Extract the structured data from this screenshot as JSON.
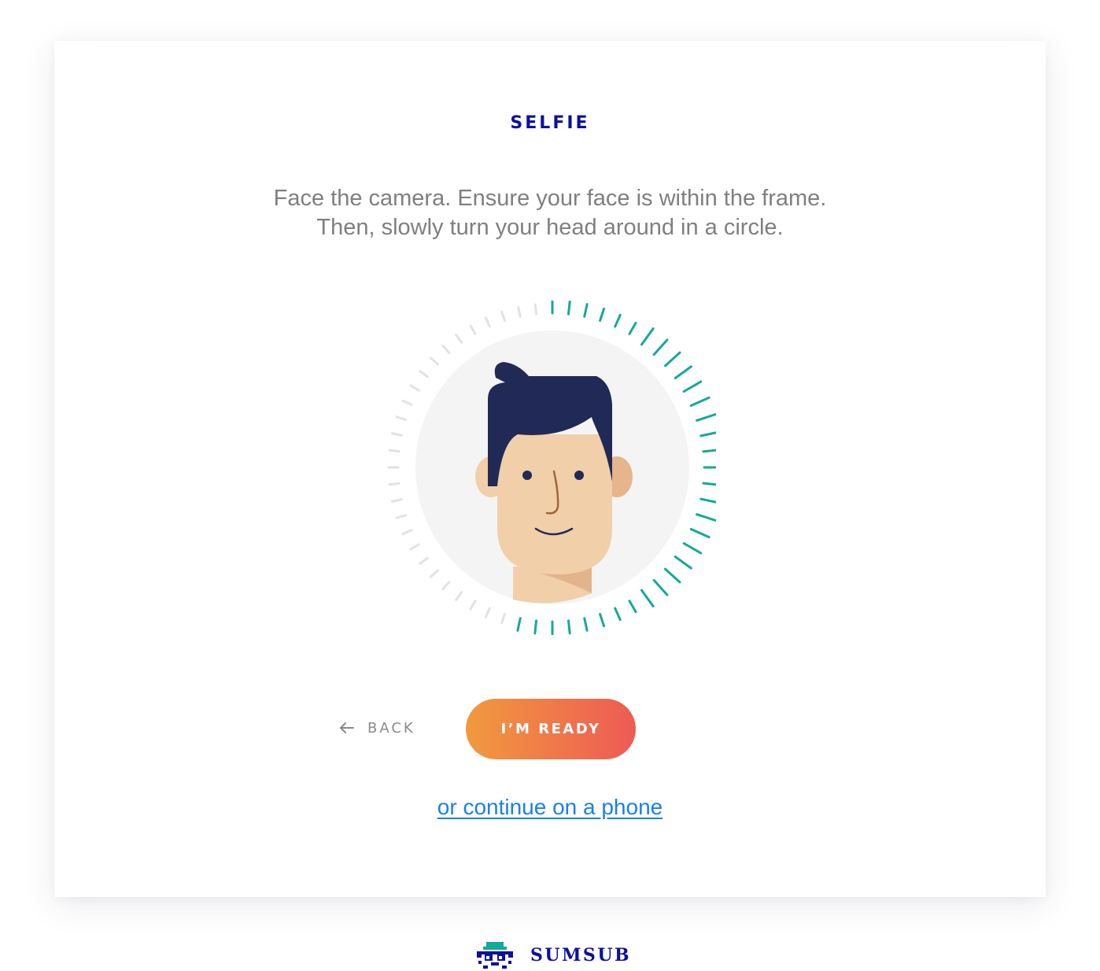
{
  "page": {
    "title": "SELFIE",
    "instructions": [
      "Face the camera. Ensure your face is within the frame.",
      "Then, slowly turn your head around in a circle."
    ]
  },
  "actions": {
    "back_label": "BACK",
    "ready_label": "I’M READY",
    "phone_link_label": "or continue on a phone"
  },
  "progress_ring": {
    "total_ticks": 60,
    "completed_fraction": 0.55,
    "active_color": "#14a99a",
    "inactive_color": "#e2e2e2"
  },
  "footer": {
    "brand_name": "SUMSUB"
  },
  "colors": {
    "title": "#0b10a0",
    "button_gradient_start": "#f19a3e",
    "button_gradient_end": "#ee5a55",
    "link": "#1a7ef0",
    "hair": "#212a56",
    "skin": "#f1cfa8"
  },
  "icons": {
    "back": "arrow-left-icon",
    "brand": "sumsub-logo-icon",
    "avatar": "face-avatar-icon"
  }
}
